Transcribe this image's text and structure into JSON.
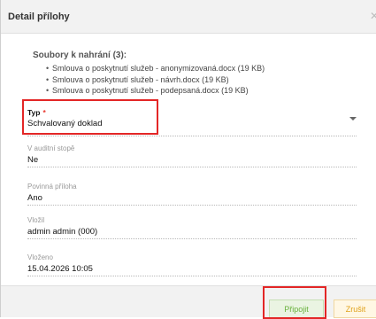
{
  "dialog": {
    "title": "Detail přílohy",
    "close_icon": "close-icon"
  },
  "upload": {
    "heading": "Soubory k nahrání (3):",
    "files": [
      "Smlouva o poskytnutí služeb - anonymizovaná.docx (19 KB)",
      "Smlouva o poskytnutí služeb - návrh.docx (19 KB)",
      "Smlouva o poskytnutí služeb - podepsaná.docx (19 KB)"
    ]
  },
  "fields": {
    "typ": {
      "label": "Typ",
      "required_mark": "*",
      "value": "Schvalovaný doklad"
    },
    "audit": {
      "label": "V auditní stopě",
      "value": "Ne"
    },
    "povinna": {
      "label": "Povinná příloha",
      "value": "Ano"
    },
    "vlozil": {
      "label": "Vložil",
      "value": "admin admin (000)"
    },
    "vlozeno": {
      "label": "Vloženo",
      "value": "15.04.2026 10:05"
    }
  },
  "footer": {
    "attach_label": "Připojit",
    "cancel_label": "Zrušit"
  },
  "colors": {
    "highlight": "#e32626",
    "attach_text": "#69b13d",
    "cancel_text": "#e0a21b",
    "required": "#e8362c"
  }
}
